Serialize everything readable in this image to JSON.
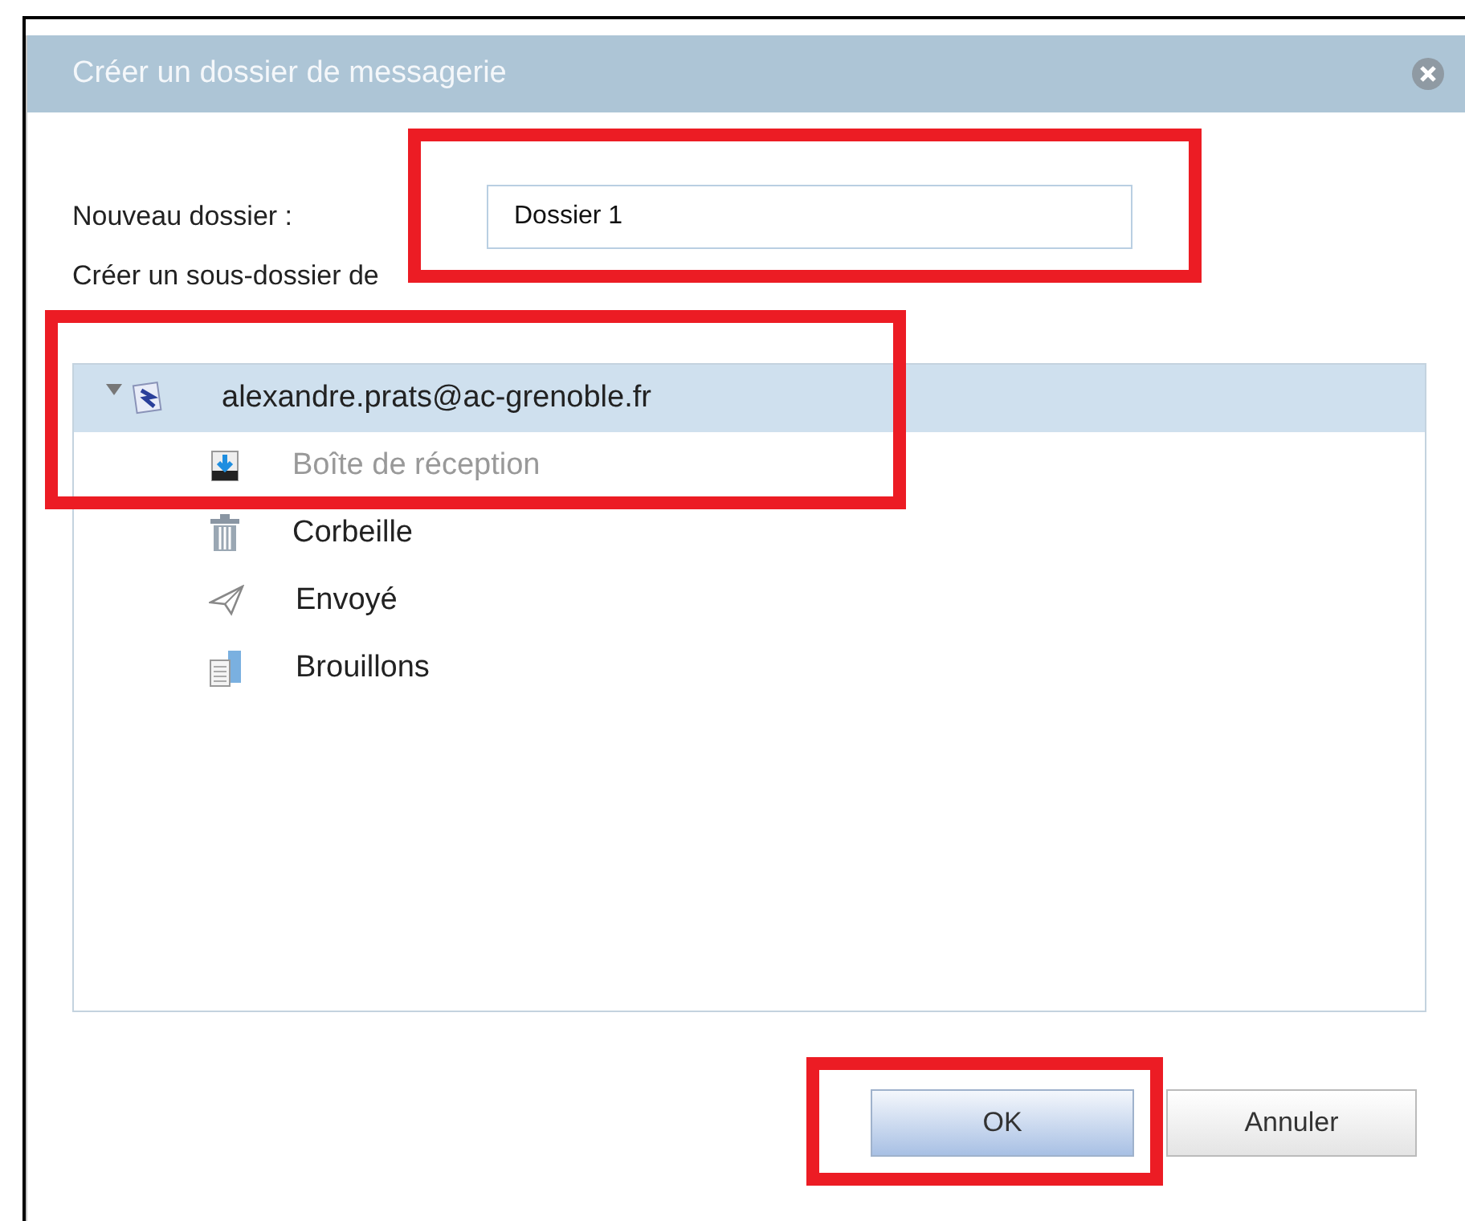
{
  "dialog": {
    "title": "Créer un dossier de messagerie"
  },
  "new_folder": {
    "label": "Nouveau dossier :",
    "value": "Dossier 1"
  },
  "parent_label": "Créer un sous-dossier de",
  "tree": [
    {
      "label": "alexandre.prats@ac-grenoble.fr",
      "kind": "account",
      "selected": true,
      "expanded": true,
      "disabled": false,
      "children": [
        {
          "label": "Boîte de réception",
          "kind": "inbox",
          "selected": false,
          "disabled": true
        },
        {
          "label": "Corbeille",
          "kind": "trash",
          "selected": false,
          "disabled": false
        },
        {
          "label": "Envoyé",
          "kind": "sent",
          "selected": false,
          "disabled": false
        },
        {
          "label": "Brouillons",
          "kind": "drafts",
          "selected": false,
          "disabled": false
        }
      ]
    }
  ],
  "buttons": [
    {
      "label": "OK",
      "kind": "primary"
    },
    {
      "label": "Annuler",
      "kind": "secondary"
    }
  ]
}
